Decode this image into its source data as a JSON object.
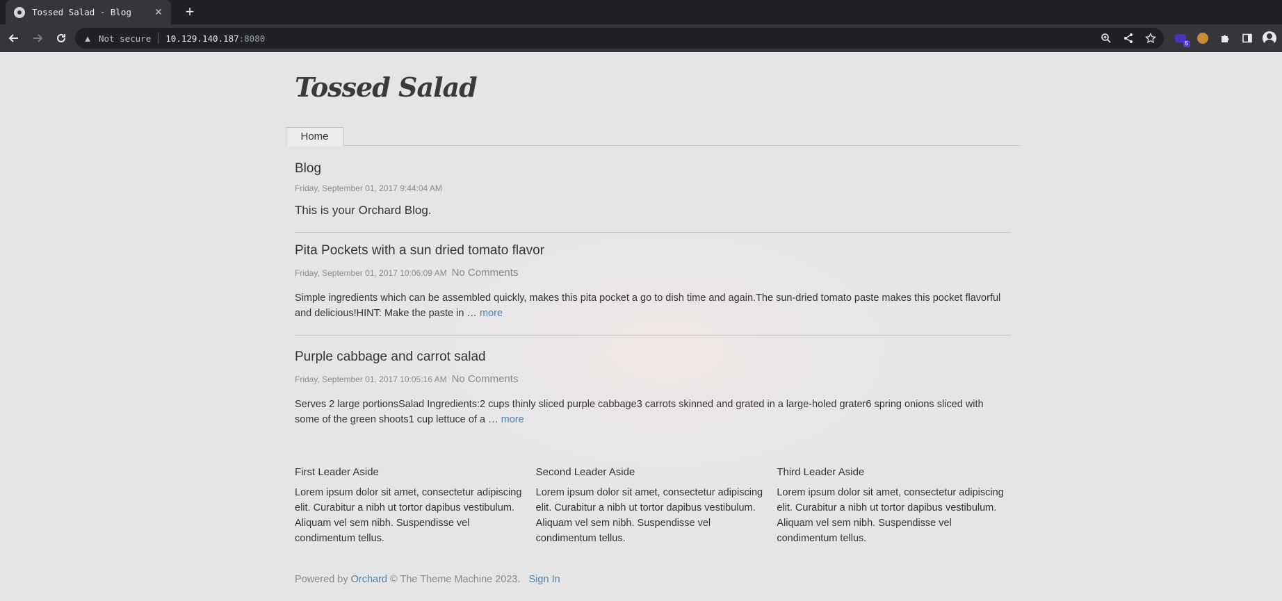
{
  "browser": {
    "tab_title": "Tossed Salad - Blog",
    "not_secure": "Not secure",
    "url_host": "10.129.140.187",
    "url_port": ":8080",
    "extension_badge": "5"
  },
  "site": {
    "title": "Tossed Salad",
    "menu": [
      {
        "label": "Home"
      }
    ]
  },
  "blog": {
    "title": "Blog",
    "date": "Friday, September 01, 2017 9:44:04 AM",
    "description": "This is your Orchard Blog."
  },
  "posts": [
    {
      "title": "Pita Pockets with a sun dried tomato flavor",
      "date": "Friday, September 01, 2017 10:06:09 AM",
      "comments": "No Comments",
      "summary": "Simple ingredients which can be assembled quickly, makes this pita pocket a go to dish time and again.The sun-dried tomato paste makes this pocket flavorful and delicious!HINT:  Make the paste in … ",
      "more": "more"
    },
    {
      "title": "Purple cabbage and carrot salad",
      "date": "Friday, September 01, 2017 10:05:16 AM",
      "comments": "No Comments",
      "summary": "Serves 2 large portionsSalad Ingredients:2 cups thinly sliced purple cabbage3 carrots skinned and grated in a large-holed grater6 spring onions sliced with some of the green shoots1 cup lettuce of a … ",
      "more": "more"
    }
  ],
  "asides": [
    {
      "title": "First Leader Aside",
      "body": "Lorem ipsum dolor sit amet, consectetur adipiscing elit. Curabitur a nibh ut tortor dapibus vestibulum. Aliquam vel sem nibh. Suspendisse vel condimentum tellus."
    },
    {
      "title": "Second Leader Aside",
      "body": "Lorem ipsum dolor sit amet, consectetur adipiscing elit. Curabitur a nibh ut tortor dapibus vestibulum. Aliquam vel sem nibh. Suspendisse vel condimentum tellus."
    },
    {
      "title": "Third Leader Aside",
      "body": "Lorem ipsum dolor sit amet, consectetur adipiscing elit. Curabitur a nibh ut tortor dapibus vestibulum. Aliquam vel sem nibh. Suspendisse vel condimentum tellus."
    }
  ],
  "footer": {
    "powered_by": "Powered by ",
    "orchard": "Orchard",
    "copyright": " © The Theme Machine 2023.",
    "sign_in": "Sign In"
  },
  "colors": {
    "link": "#4f80a6",
    "page_background": "#e5e5e5",
    "chrome_dark": "#202124",
    "chrome_toolbar": "#35363a"
  },
  "icons": {
    "favicon": "orchard-favicon-icon",
    "back": "arrow-left-icon",
    "forward": "arrow-right-icon",
    "reload": "reload-icon",
    "warning": "warning-icon",
    "zoom": "zoom-icon",
    "share": "share-icon",
    "bookmark": "star-icon",
    "extensions": "puzzle-icon",
    "side_panel": "side-panel-icon",
    "profile": "profile-icon"
  }
}
